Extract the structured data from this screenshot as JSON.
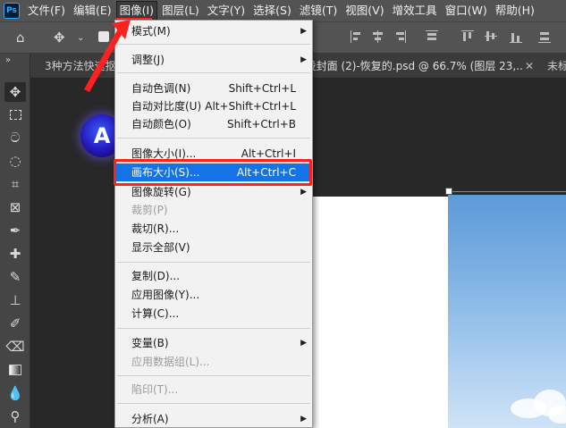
{
  "app": {
    "logo_text": "Ps"
  },
  "menubar": {
    "items": [
      "文件(F)",
      "编辑(E)",
      "图像(I)",
      "图层(L)",
      "文字(Y)",
      "选择(S)",
      "滤镜(T)",
      "视图(V)",
      "增效工具",
      "窗口(W)",
      "帮助(H)"
    ],
    "active_index": 2
  },
  "tabs": [
    {
      "label": "3种方法快速抠"
    },
    {
      "label": "..设封面 (2)-恢复的.psd @ 66.7% (图层 23,..."
    },
    {
      "label": "未标"
    }
  ],
  "image_menu": {
    "sections": [
      [
        {
          "label": "模式(M)",
          "submenu": true
        }
      ],
      [
        {
          "label": "调整(J)",
          "submenu": true
        }
      ],
      [
        {
          "label": "自动色调(N)",
          "shortcut": "Shift+Ctrl+L"
        },
        {
          "label": "自动对比度(U)",
          "shortcut": "Alt+Shift+Ctrl+L"
        },
        {
          "label": "自动颜色(O)",
          "shortcut": "Shift+Ctrl+B"
        }
      ],
      [
        {
          "label": "图像大小(I)...",
          "shortcut": "Alt+Ctrl+I"
        },
        {
          "label": "画布大小(S)...",
          "shortcut": "Alt+Ctrl+C",
          "highlighted": true
        },
        {
          "label": "图像旋转(G)",
          "submenu": true
        },
        {
          "label": "裁剪(P)",
          "disabled": true
        },
        {
          "label": "裁切(R)..."
        },
        {
          "label": "显示全部(V)"
        }
      ],
      [
        {
          "label": "复制(D)..."
        },
        {
          "label": "应用图像(Y)..."
        },
        {
          "label": "计算(C)..."
        }
      ],
      [
        {
          "label": "变量(B)",
          "submenu": true
        },
        {
          "label": "应用数据组(L)...",
          "disabled": true
        }
      ],
      [
        {
          "label": "陷印(T)...",
          "disabled": true
        }
      ],
      [
        {
          "label": "分析(A)",
          "submenu": true
        }
      ]
    ]
  },
  "colors": {
    "menubar_bg": "#535353",
    "dropdown_bg": "#f2f2f2",
    "highlight": "#1473e6",
    "annotation_red": "#ff2020"
  }
}
